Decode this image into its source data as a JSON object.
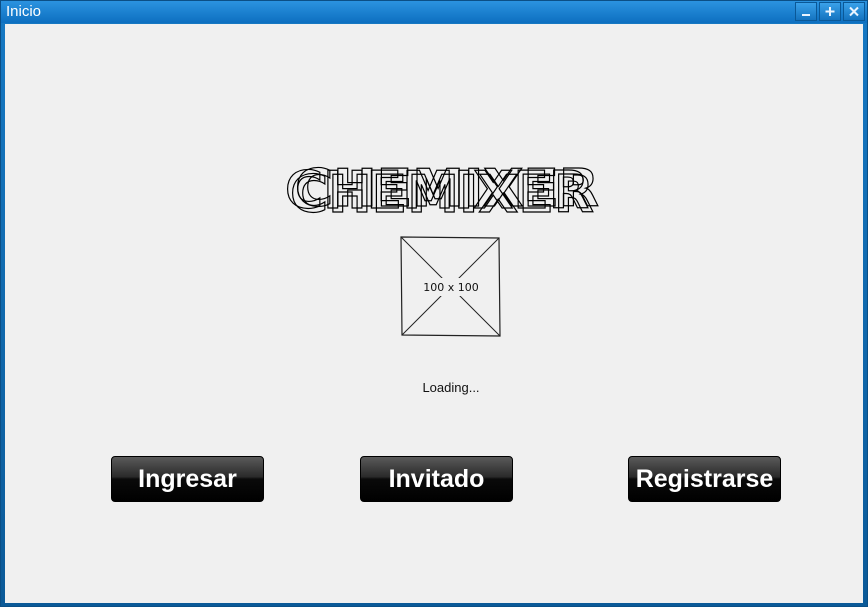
{
  "window": {
    "title": "Inicio",
    "controls": {
      "minimize_icon": "minimize-icon",
      "maximize_icon": "maximize-icon",
      "close_icon": "close-icon"
    }
  },
  "logo": {
    "text": "CHEMIXER"
  },
  "image_placeholder": {
    "label": "100 x 100"
  },
  "status": {
    "text": "Loading..."
  },
  "buttons": {
    "ingresar": "Ingresar",
    "invitado": "Invitado",
    "registrarse": "Registrarse"
  }
}
